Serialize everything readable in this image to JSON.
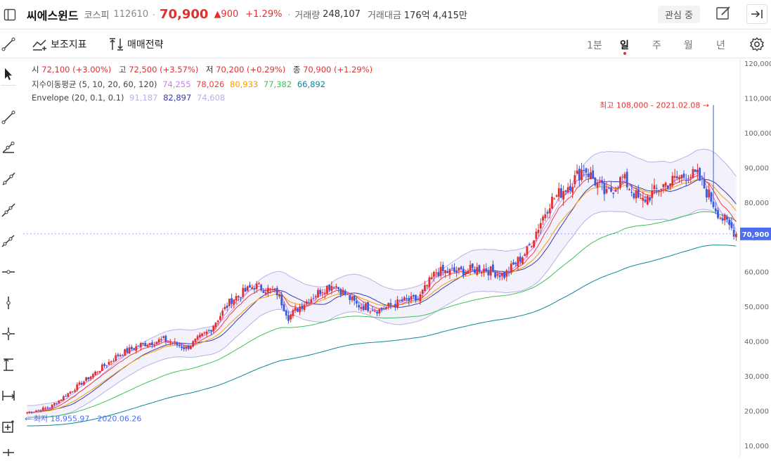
{
  "header": {
    "stock_name": "씨에스윈드",
    "market": "코스피",
    "code": "112610",
    "price": "70,900",
    "change": "▲900",
    "change_pct": "+1.29%",
    "volume_label": "거래량",
    "volume": "248,107",
    "amount_label": "거래대금",
    "amount": "176억 4,415만",
    "watch_label": "관심 중"
  },
  "toolbar": {
    "indicators_label": "보조지표",
    "strategy_label": "매매전략",
    "intervals": [
      "1분",
      "일",
      "주",
      "월",
      "년"
    ],
    "active_interval": "일"
  },
  "legend": {
    "ohlc": {
      "open_label": "시",
      "open": "72,100 (+3.00%)",
      "high_label": "고",
      "high": "72,500 (+3.57%)",
      "low_label": "저",
      "low": "70,200 (+0.29%)",
      "close_label": "종",
      "close": "70,900 (+1.29%)"
    },
    "ema_label": "지수이동평균 (5, 10, 20, 60, 120)",
    "ema_values": [
      "74,255",
      "78,026",
      "80,933",
      "77,382",
      "66,892"
    ],
    "envelope_label": "Envelope (20, 0.1, 0.1)",
    "envelope_values": [
      "91,187",
      "82,897",
      "74,608"
    ]
  },
  "annotations": {
    "high": "최고 108,000 - 2021.02.08 →",
    "low": "← 최저 18,955.97 - 2020.06.26"
  },
  "colors": {
    "up": "#e03131",
    "down": "#3b5bdb",
    "ema5": "#c77dff",
    "ema10": "#f03e3e",
    "ema20": "#f59f00",
    "ema60": "#40c057",
    "ema120": "#0c8599",
    "env_upper": "#b8b0ea",
    "env_mid": "#3b3bb3",
    "env_lower": "#b8b0ea"
  },
  "chart_data": {
    "type": "candlestick",
    "y_axis": {
      "ticks": [
        10000,
        20000,
        30000,
        40000,
        50000,
        60000,
        70000,
        80000,
        90000,
        100000,
        110000,
        120000
      ],
      "tick_labels": [
        "10,000",
        "20,000",
        "30,000",
        "40,000",
        "50,000",
        "60,000",
        "70,000",
        "80,000",
        "90,000",
        "100,000",
        "110,000",
        "120,000"
      ],
      "range": [
        10000,
        120000
      ]
    },
    "last_price_label": "70,900",
    "last_price": 70900,
    "anchors": [
      [
        0,
        19500
      ],
      [
        10,
        21000
      ],
      [
        20,
        26000
      ],
      [
        30,
        31000
      ],
      [
        40,
        36000
      ],
      [
        50,
        39000
      ],
      [
        60,
        40500
      ],
      [
        70,
        38000
      ],
      [
        80,
        43000
      ],
      [
        90,
        52000
      ],
      [
        100,
        56000
      ],
      [
        110,
        54000
      ],
      [
        115,
        47000
      ],
      [
        120,
        50000
      ],
      [
        130,
        55000
      ],
      [
        135,
        56500
      ],
      [
        145,
        50500
      ],
      [
        155,
        49000
      ],
      [
        165,
        51500
      ],
      [
        172,
        52000
      ],
      [
        180,
        60000
      ],
      [
        190,
        60000
      ],
      [
        200,
        61000
      ],
      [
        210,
        59000
      ],
      [
        220,
        66000
      ],
      [
        230,
        80000
      ],
      [
        240,
        86000
      ],
      [
        245,
        90000
      ],
      [
        255,
        82000
      ],
      [
        262,
        87000
      ],
      [
        270,
        80000
      ],
      [
        280,
        85000
      ],
      [
        290,
        88000
      ],
      [
        295,
        87500
      ],
      [
        300,
        82000
      ],
      [
        305,
        76000
      ],
      [
        312,
        71000
      ]
    ],
    "high_point": {
      "value": 108000,
      "date": "2021.02.08"
    },
    "low_point": {
      "value": 18955.97,
      "date": "2020.06.26"
    }
  }
}
